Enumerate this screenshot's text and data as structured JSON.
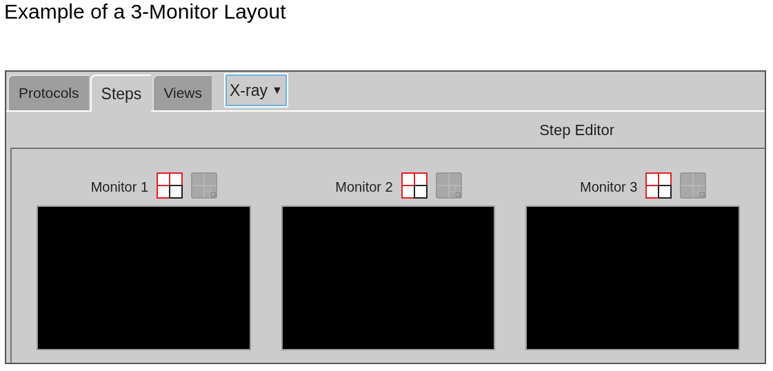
{
  "heading": "Example of a 3-Monitor Layout",
  "tabs": [
    {
      "label": "Protocols",
      "selected": false
    },
    {
      "label": "Steps",
      "selected": true
    },
    {
      "label": "Views",
      "selected": false
    }
  ],
  "modality_dropdown": {
    "value": "X-ray",
    "arrow": "▼"
  },
  "editor_title": "Step Editor",
  "monitors": [
    {
      "label": "Monitor 1",
      "layouts": [
        {
          "kind": "quad",
          "selected": true
        },
        {
          "kind": "grid",
          "selected": false
        }
      ]
    },
    {
      "label": "Monitor 2",
      "layouts": [
        {
          "kind": "quad",
          "selected": true
        },
        {
          "kind": "grid",
          "selected": false
        }
      ]
    },
    {
      "label": "Monitor 3",
      "layouts": [
        {
          "kind": "quad",
          "selected": true
        },
        {
          "kind": "grid",
          "selected": false
        }
      ]
    }
  ]
}
